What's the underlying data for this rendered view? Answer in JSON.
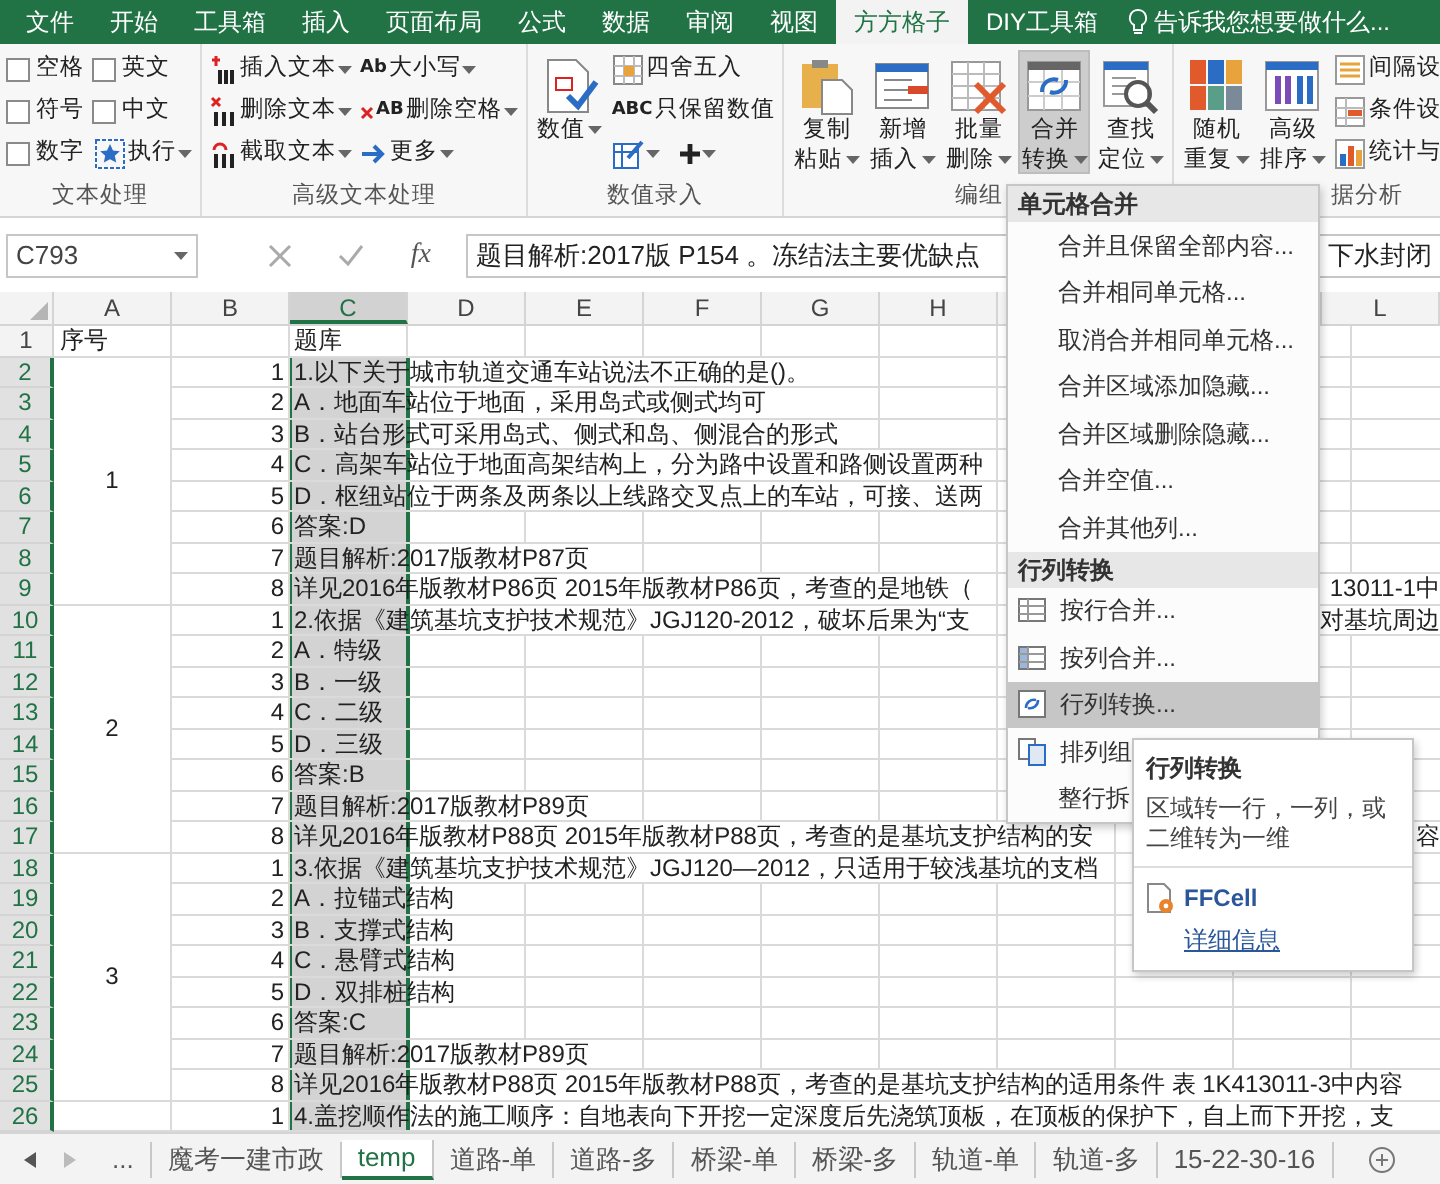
{
  "ribbon": {
    "tabs": [
      {
        "label": "文件",
        "selected": false
      },
      {
        "label": "开始",
        "selected": false
      },
      {
        "label": "工具箱",
        "selected": false
      },
      {
        "label": "插入",
        "selected": false
      },
      {
        "label": "页面布局",
        "selected": false
      },
      {
        "label": "公式",
        "selected": false
      },
      {
        "label": "数据",
        "selected": false
      },
      {
        "label": "审阅",
        "selected": false
      },
      {
        "label": "视图",
        "selected": false
      },
      {
        "label": "方方格子",
        "selected": true
      },
      {
        "label": "DIY工具箱",
        "selected": false
      }
    ],
    "tell_me": "告诉我您想要做什么...",
    "groups": [
      {
        "label": "文本处理",
        "columns": [
          [
            {
              "kind": "checkbox",
              "label": "空格",
              "checked": false
            },
            {
              "kind": "checkbox",
              "label": "符号",
              "checked": false
            },
            {
              "kind": "checkbox",
              "label": "数字",
              "checked": false
            }
          ],
          [
            {
              "kind": "checkbox",
              "label": "英文",
              "checked": false
            },
            {
              "kind": "checkbox",
              "label": "中文",
              "checked": false
            },
            {
              "kind": "small",
              "label": "执行",
              "dropdown": true
            }
          ]
        ]
      },
      {
        "label": "高级文本处理",
        "columns": [
          [
            {
              "kind": "small",
              "label": "插入文本",
              "dropdown": true
            },
            {
              "kind": "small",
              "label": "删除文本",
              "dropdown": true
            },
            {
              "kind": "small",
              "label": "截取文本",
              "dropdown": true
            }
          ],
          [
            {
              "kind": "small",
              "icon_text": "Ab",
              "label": "大小写",
              "dropdown": true
            },
            {
              "kind": "small",
              "icon_text": "AB",
              "label": "删除空格",
              "dropdown": true
            },
            {
              "kind": "small",
              "label": "更多",
              "dropdown": true
            }
          ]
        ]
      },
      {
        "label": "数值录入",
        "columns": [
          [
            {
              "kind": "large",
              "label": "数值",
              "dropdown": true,
              "pressed": false
            }
          ],
          [
            {
              "kind": "small",
              "label": "四舍五入",
              "dropdown": false
            },
            {
              "kind": "small",
              "icon_text": "ABC",
              "label": "只保留数值",
              "dropdown": false
            },
            {
              "kind": "pair",
              "items": [
                {
                  "kind": "small",
                  "dropdown": true
                },
                {
                  "kind": "small",
                  "dropdown": true
                }
              ]
            }
          ]
        ]
      },
      {
        "label": "编组",
        "columns": [
          [
            {
              "kind": "large",
              "label": "复制粘贴",
              "dropdown": true,
              "pressed": false
            }
          ],
          [
            {
              "kind": "large",
              "label": "新增插入",
              "dropdown": true,
              "pressed": false
            }
          ],
          [
            {
              "kind": "large",
              "label": "批量删除",
              "dropdown": true,
              "pressed": false
            }
          ],
          [
            {
              "kind": "large",
              "label": "合并转换",
              "dropdown": true,
              "pressed": true
            }
          ],
          [
            {
              "kind": "large",
              "label": "查找定位",
              "dropdown": true,
              "pressed": false
            }
          ]
        ]
      },
      {
        "label": "据分析",
        "columns": [
          [
            {
              "kind": "large",
              "label": "随机重复",
              "dropdown": true,
              "pressed": false
            }
          ],
          [
            {
              "kind": "large",
              "label": "高级排序",
              "dropdown": true,
              "pressed": false
            }
          ],
          [
            {
              "kind": "small",
              "label": "间隔设",
              "dropdown": false
            },
            {
              "kind": "small",
              "label": "条件设",
              "dropdown": false
            },
            {
              "kind": "small",
              "label": "统计与",
              "dropdown": false
            }
          ]
        ]
      }
    ]
  },
  "formula_bar": {
    "name_box": "C793",
    "fx": "fx",
    "formula": "题目解析:2017版 P154 。冻结法主要优缺点",
    "formula_right": "下水封闭"
  },
  "sheet": {
    "columns": [
      {
        "label": "A",
        "selected": false
      },
      {
        "label": "B",
        "selected": false
      },
      {
        "label": "C",
        "selected": true
      },
      {
        "label": "D",
        "selected": false
      },
      {
        "label": "E",
        "selected": false
      },
      {
        "label": "F",
        "selected": false
      },
      {
        "label": "G",
        "selected": false
      },
      {
        "label": "H",
        "selected": false
      },
      {
        "label": "L",
        "selected": false
      }
    ],
    "header_row": {
      "number": "1",
      "selected": false,
      "a": "序号",
      "c": "题库"
    },
    "groups": [
      {
        "label": "1",
        "rows": [
          {
            "number": "2",
            "selected": true,
            "b": "1",
            "c": "1.以下关于城市轨道交通车站说法不正确的是()。"
          },
          {
            "number": "3",
            "selected": true,
            "b": "2",
            "c": "A．地面车站位于地面，采用岛式或侧式均可"
          },
          {
            "number": "4",
            "selected": true,
            "b": "3",
            "c": "B．站台形式可采用岛式、侧式和岛、侧混合的形式"
          },
          {
            "number": "5",
            "selected": true,
            "b": "4",
            "c": "C．高架车站位于地面高架结构上，分为路中设置和路侧设置两种"
          },
          {
            "number": "6",
            "selected": true,
            "b": "5",
            "c": "D．枢纽站位于两条及两条以上线路交叉点上的车站，可接、送两"
          },
          {
            "number": "7",
            "selected": true,
            "b": "6",
            "c": "答案:D"
          },
          {
            "number": "8",
            "selected": true,
            "b": "7",
            "c": "题目解析:2017版教材P87页"
          },
          {
            "number": "9",
            "selected": true,
            "b": "8",
            "c": "详见2016年版教材P86页 2015年版教材P86页，考查的是地铁（",
            "c_right": "13011-1中"
          }
        ]
      },
      {
        "label": "2",
        "rows": [
          {
            "number": "10",
            "selected": true,
            "b": "1",
            "c": "2.依据《建筑基坑支护技术规范》JGJ120-2012，破坏后果为“支",
            "c_right": "对基坑周边"
          },
          {
            "number": "11",
            "selected": true,
            "b": "2",
            "c": "A．特级"
          },
          {
            "number": "12",
            "selected": true,
            "b": "3",
            "c": "B．一级"
          },
          {
            "number": "13",
            "selected": true,
            "b": "4",
            "c": "C．二级"
          },
          {
            "number": "14",
            "selected": true,
            "b": "5",
            "c": "D．三级"
          },
          {
            "number": "15",
            "selected": true,
            "b": "6",
            "c": "答案:B"
          },
          {
            "number": "16",
            "selected": true,
            "b": "7",
            "c": "题目解析:2017版教材P89页"
          },
          {
            "number": "17",
            "selected": true,
            "b": "8",
            "c": "详见2016年版教材P88页 2015年版教材P88页，考查的是基坑支护结构的安",
            "c_right": "容"
          }
        ]
      },
      {
        "label": "3",
        "rows": [
          {
            "number": "18",
            "selected": true,
            "b": "1",
            "c": "3.依据《建筑基坑支护技术规范》JGJ120—2012，只适用于较浅基坑的支档"
          },
          {
            "number": "19",
            "selected": true,
            "b": "2",
            "c": "A．拉锚式结构"
          },
          {
            "number": "20",
            "selected": true,
            "b": "3",
            "c": "B．支撑式结构"
          },
          {
            "number": "21",
            "selected": true,
            "b": "4",
            "c": "C．悬臂式结构"
          },
          {
            "number": "22",
            "selected": true,
            "b": "5",
            "c": "D．双排桩结构"
          },
          {
            "number": "23",
            "selected": true,
            "b": "6",
            "c": "答案:C"
          },
          {
            "number": "24",
            "selected": true,
            "b": "7",
            "c": "题目解析:2017版教材P89页"
          },
          {
            "number": "25",
            "selected": true,
            "b": "8",
            "c": "详见2016年版教材P88页 2015年版教材P88页，考查的是基坑支护结构的适用条件 表 1K413011-3中内容"
          }
        ]
      },
      {
        "rows": [
          {
            "number": "26",
            "selected": true,
            "b": "1",
            "c": "4.盖挖顺作法的施工顺序：自地表向下开挖一定深度后先浇筑顶板，在顶板的保护下，自上而下开挖，支"
          }
        ]
      }
    ]
  },
  "menu": {
    "sections": [
      {
        "title": "单元格合并",
        "items": [
          {
            "label": "合并且保留全部内容...",
            "selected": false
          },
          {
            "label": "合并相同单元格...",
            "selected": false
          },
          {
            "label": "取消合并相同单元格...",
            "selected": false
          },
          {
            "label": "合并区域添加隐藏...",
            "selected": false
          },
          {
            "label": "合并区域删除隐藏...",
            "selected": false
          },
          {
            "label": "合并空值...",
            "selected": false
          },
          {
            "label": "合并其他列...",
            "selected": false
          }
        ]
      },
      {
        "title": "行列转换",
        "items": [
          {
            "label": "按行合并...",
            "selected": false
          },
          {
            "label": "按列合并...",
            "selected": false
          },
          {
            "label": "行列转换...",
            "selected": true
          },
          {
            "label": "排列组",
            "selected": false
          },
          {
            "label": "整行拆",
            "selected": false
          }
        ]
      }
    ]
  },
  "tooltip": {
    "title": "行列转换",
    "description": "区域转一行，一列，或二维转为一维",
    "addin": "FFCell",
    "link": "详细信息"
  },
  "sheet_tabs": {
    "more": "...",
    "tabs": [
      {
        "label": "魔考一建市政",
        "selected": false
      },
      {
        "label": "temp",
        "selected": true
      },
      {
        "label": "道路-单",
        "selected": false
      },
      {
        "label": "道路-多",
        "selected": false
      },
      {
        "label": "桥梁-单",
        "selected": false
      },
      {
        "label": "桥梁-多",
        "selected": false
      },
      {
        "label": "轨道-单",
        "selected": false
      },
      {
        "label": "轨道-多",
        "selected": false
      },
      {
        "label": "15-22-30-16",
        "selected": false
      }
    ]
  }
}
